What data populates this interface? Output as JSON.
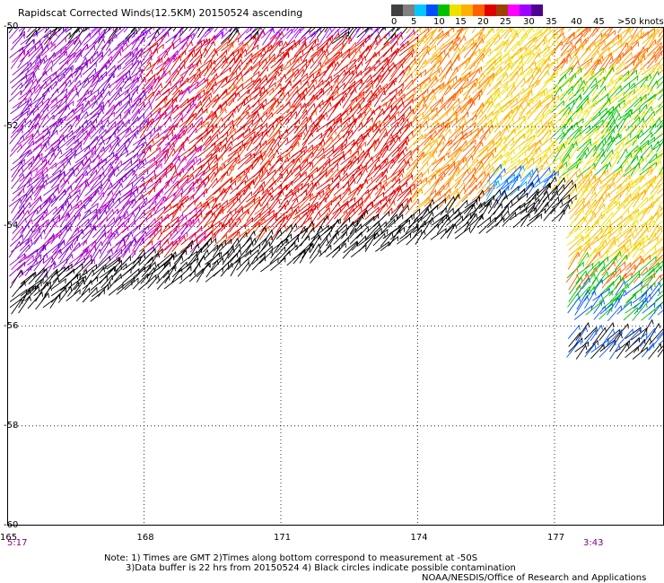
{
  "title": "Rapidscat Corrected Winds(12.5KM) 20150524 ascending",
  "legend": {
    "labels": [
      "0",
      "5",
      "10",
      "15",
      "20",
      "25",
      "30",
      "35",
      "40",
      "45",
      ">50 knots"
    ],
    "colors": [
      "#404040",
      "#808080",
      "#00c8ff",
      "#0050ff",
      "#00c000",
      "#f0e000",
      "#ffb000",
      "#ff6000",
      "#e00000",
      "#a04000",
      "#ff00ff",
      "#a000ff",
      "#500090"
    ]
  },
  "axes": {
    "lat_labels": [
      "-50",
      "-52",
      "-54",
      "-56",
      "-58",
      "-60"
    ],
    "lon_labels": [
      "165",
      "168",
      "171",
      "174",
      "177"
    ],
    "lat_range": [
      -60,
      -50
    ],
    "lon_range": [
      165,
      179.4
    ],
    "grid": true
  },
  "times": {
    "left": "5:17",
    "right": "3:43"
  },
  "notes": {
    "line1": "Note: 1) Times are GMT 2)Times along bottom correspond to measurement at -50S",
    "line2": "3)Data buffer is 22 hrs from 20150524 4) Black circles indicate possible contamination",
    "line3": "NOAA/NESDIS/Office of Research and Applications"
  },
  "wind_field": {
    "swath_main": {
      "description_color_zones": [
        "purple",
        "red",
        "orange",
        "yellow",
        "green",
        "blue"
      ],
      "north_edge_lat": -50,
      "south_edge_lat_west": -55.8,
      "south_edge_lat_east": -53.9
    },
    "swath_east_patch": {
      "lon_range": [
        177,
        179.4
      ],
      "lat_range": [
        -54,
        -56.7
      ]
    }
  }
}
